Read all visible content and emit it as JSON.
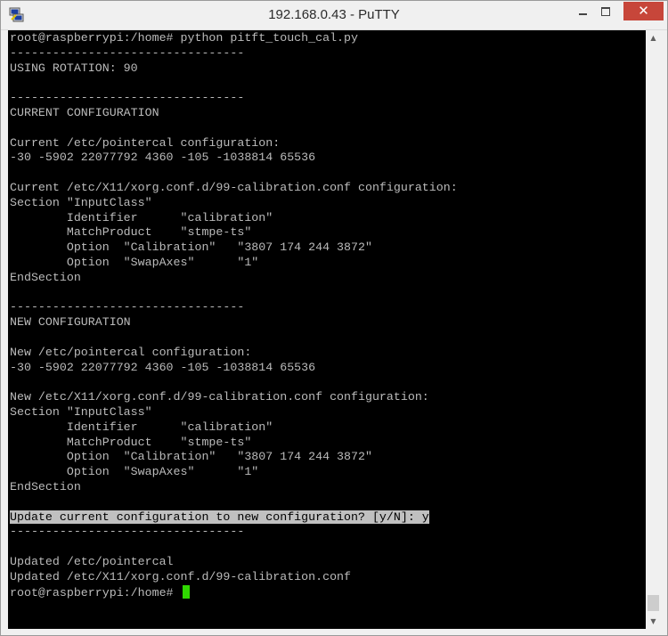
{
  "window": {
    "title": "192.168.0.43 - PuTTY",
    "icon": "putty-icon",
    "buttons": {
      "minimize_icon": "minimize-icon",
      "maximize_icon": "maximize-icon",
      "close_icon": "close-icon",
      "close_glyph": "✕"
    },
    "accent_close": "#c7463a"
  },
  "terminal": {
    "background": "#000000",
    "foreground": "#bbbbbb",
    "cursor_color": "#2fd800",
    "lines": [
      "root@raspberrypi:/home# python pitft_touch_cal.py",
      "---------------------------------",
      "USING ROTATION: 90",
      "",
      "---------------------------------",
      "CURRENT CONFIGURATION",
      "",
      "Current /etc/pointercal configuration:",
      "-30 -5902 22077792 4360 -105 -1038814 65536",
      "",
      "Current /etc/X11/xorg.conf.d/99-calibration.conf configuration:",
      "Section \"InputClass\"",
      "        Identifier      \"calibration\"",
      "        MatchProduct    \"stmpe-ts\"",
      "        Option  \"Calibration\"   \"3807 174 244 3872\"",
      "        Option  \"SwapAxes\"      \"1\"",
      "EndSection",
      "",
      "---------------------------------",
      "NEW CONFIGURATION",
      "",
      "New /etc/pointercal configuration:",
      "-30 -5902 22077792 4360 -105 -1038814 65536",
      "",
      "New /etc/X11/xorg.conf.d/99-calibration.conf configuration:",
      "Section \"InputClass\"",
      "        Identifier      \"calibration\"",
      "        MatchProduct    \"stmpe-ts\"",
      "        Option  \"Calibration\"   \"3807 174 244 3872\"",
      "        Option  \"SwapAxes\"      \"1\"",
      "EndSection",
      "",
      "Update current configuration to new configuration? [y/N]: y",
      "---------------------------------",
      "",
      "Updated /etc/pointercal",
      "Updated /etc/X11/xorg.conf.d/99-calibration.conf",
      "root@raspberrypi:/home# "
    ],
    "highlighted_line_index": 32
  },
  "scrollbar": {
    "up_icon": "scroll-up-arrow-icon",
    "down_icon": "scroll-down-arrow-icon",
    "up_glyph": "▲",
    "down_glyph": "▼"
  }
}
